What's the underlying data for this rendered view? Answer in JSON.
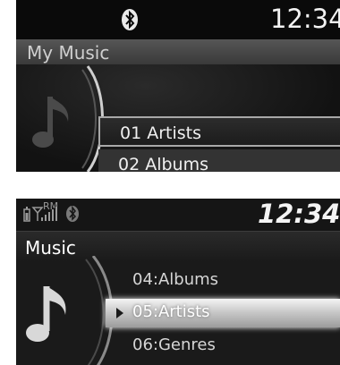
{
  "screen1": {
    "time": "12:34",
    "header_title": "My Music",
    "icons": {
      "status": "bluetooth-icon",
      "art": "music-note-icon"
    },
    "items": [
      {
        "label": "01 Artists",
        "selected": true
      },
      {
        "label": "02 Albums",
        "selected": false
      }
    ]
  },
  "screen2": {
    "time": "12:34",
    "status_icons": [
      "battery-icon",
      "signal-icon",
      "roaming-icon",
      "bluetooth-icon"
    ],
    "roaming_label": "RM",
    "header_title": "Music",
    "icons": {
      "art": "music-note-icon"
    },
    "items": [
      {
        "label": "04:Albums",
        "selected": false
      },
      {
        "label": "05:Artists",
        "selected": true
      },
      {
        "label": "06:Genres",
        "selected": false
      }
    ]
  },
  "colors": {
    "background": "#101010",
    "highlight": "#c9c9c9",
    "text": "#f0f0f0"
  }
}
